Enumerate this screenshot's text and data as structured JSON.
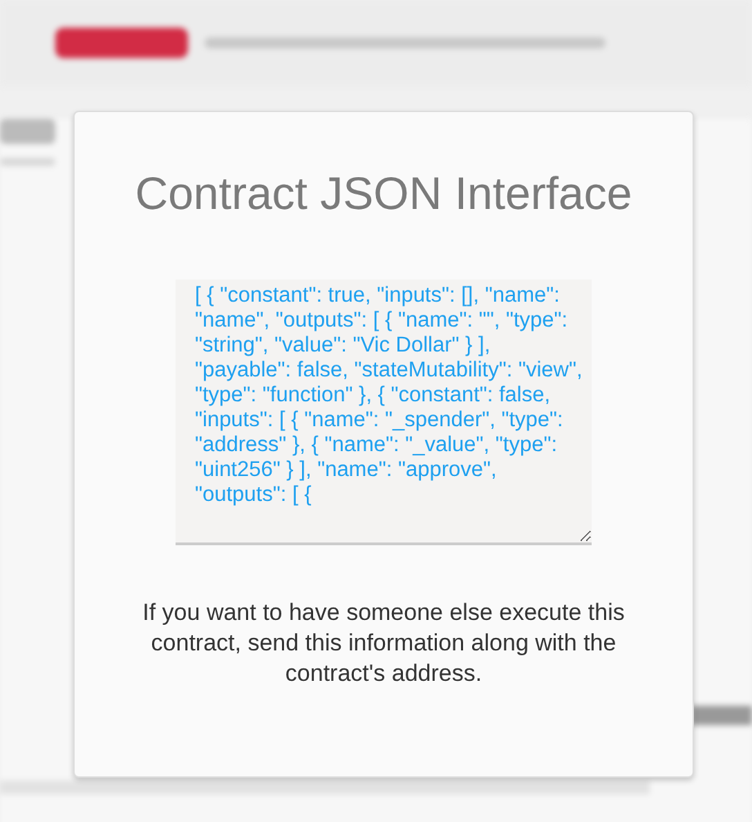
{
  "modal": {
    "title": "Contract JSON Interface",
    "json_field": {
      "value": "[ { \"constant\": true, \"inputs\": [], \"name\": \"name\", \"outputs\": [ { \"name\": \"\", \"type\": \"string\", \"value\": \"Vic Dollar\" } ], \"payable\": false, \"stateMutability\": \"view\", \"type\": \"function\" }, { \"constant\": false, \"inputs\": [ { \"name\": \"_spender\", \"type\": \"address\" }, { \"name\": \"_value\", \"type\": \"uint256\" } ], \"name\": \"approve\", \"outputs\": [ {"
    },
    "message": "If you want to have someone else execute this contract, send this information along with the contract's address."
  }
}
